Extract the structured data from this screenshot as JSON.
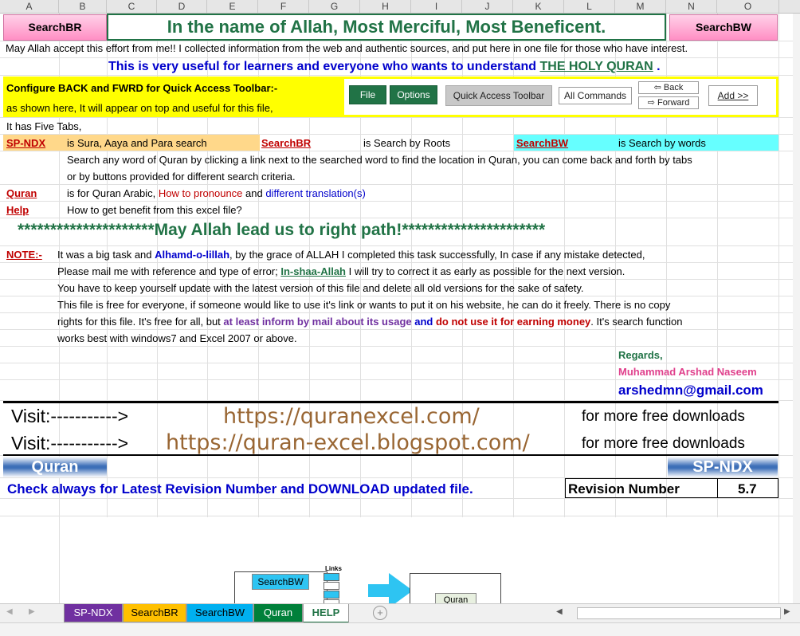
{
  "columns": [
    "A",
    "B",
    "C",
    "D",
    "E",
    "F",
    "G",
    "H",
    "I",
    "J",
    "K",
    "L",
    "M",
    "N",
    "O"
  ],
  "header": {
    "left_button": "SearchBR",
    "title": "In the name of Allah, Most Merciful, Most Beneficent.",
    "right_button": "SearchBW"
  },
  "intro_line": "May Allah accept this effort from me!!  I collected information from the web and authentic sources, and put here in one file for those who have interest.",
  "useful_line": {
    "text": "This is very useful for learners and everyone who wants to understand ",
    "link": "THE HOLY QURAN",
    "end": " ."
  },
  "configure": {
    "title": "Configure BACK and FWRD for Quick Access Toolbar:-",
    "subtitle": "as shown here, It will appear on top and useful for this file,",
    "file_btn": "File",
    "options_btn": "Options",
    "qat_btn": "Quick Access Toolbar",
    "all_commands": "All Commands",
    "back": "Back",
    "forward": "Forward",
    "add": "Add >>"
  },
  "five_tabs": "It has Five Tabs,",
  "tabs_desc": {
    "spndx_link": "SP-NDX",
    "spndx_desc": "is Sura, Aaya and Para search",
    "searchbr_link": "SearchBR",
    "searchbr_desc": "is Search by Roots",
    "searchbw_link": "SearchBW",
    "searchbw_desc": "is Search by words",
    "search_line1": "Search any word of Quran by clicking a link next to the searched word to find the location in Quran, you can come back and forth by tabs",
    "search_line2": "or by buttons provided for different search criteria.",
    "quran_link": "Quran",
    "quran_desc1": "is for Quran Arabic, ",
    "quran_desc2": "How to pronounce",
    "quran_desc3": " and ",
    "quran_desc4": "different translation(s)",
    "help_link": "Help",
    "help_desc": "How to get benefit from this excel file?"
  },
  "banner": "*********************May Allah lead us to right path!**********************",
  "note": {
    "label": "NOTE:-",
    "l1a": "It was a big task and ",
    "l1b": "Alhamd-o-lillah",
    "l1c": ", by the grace of ALLAH I completed this task successfully, In case if any mistake detected,",
    "l2a": "Please mail me with reference and type of error; ",
    "l2b": "In-shaa-Allah",
    "l2c": " I will try to correct it as early as possible for the next version.",
    "l3": "You have to keep yourself update with the latest version of this file and delete all old versions for the sake of safety.",
    "l4": "This file is free for everyone, if someone would like to use it's link or wants to put it on his website, he can do it freely. There is no copy",
    "l5a": "rights for this file. It's free for all, but ",
    "l5b": "at least inform by mail about its usage",
    "l5c": " and ",
    "l5d": "do not use it for earning money",
    "l5e": ".  It's search function",
    "l6": "works best with windows7 and Excel 2007 or above."
  },
  "regards": "Regards,",
  "author": "Muhammad Arshad Naseem",
  "email": "arshedmn@gmail.com",
  "visit": [
    {
      "label": "Visit:----------->",
      "url": "https://quranexcel.com/",
      "suffix": "for more free downloads"
    },
    {
      "label": "Visit:----------->",
      "url": "https://quran-excel.blogspot.com/",
      "suffix": "for more free downloads"
    }
  ],
  "nav_quran": "Quran",
  "nav_spndx": "SP-NDX",
  "check_line": "Check always for Latest Revision Number and DOWNLOAD updated file.",
  "revision_label": "Revision Number",
  "revision_value": "5.7",
  "diagram": {
    "searchbw": "SearchBW",
    "links": "Links",
    "quran": "Quran"
  },
  "sheet_tabs": [
    "SP-NDX",
    "SearchBR",
    "SearchBW",
    "Quran",
    "HELP"
  ],
  "active_tab": "HELP",
  "colors": {
    "green": "#217346",
    "navy": "#0000cc",
    "red": "#c00000",
    "purple": "#7030a0"
  }
}
